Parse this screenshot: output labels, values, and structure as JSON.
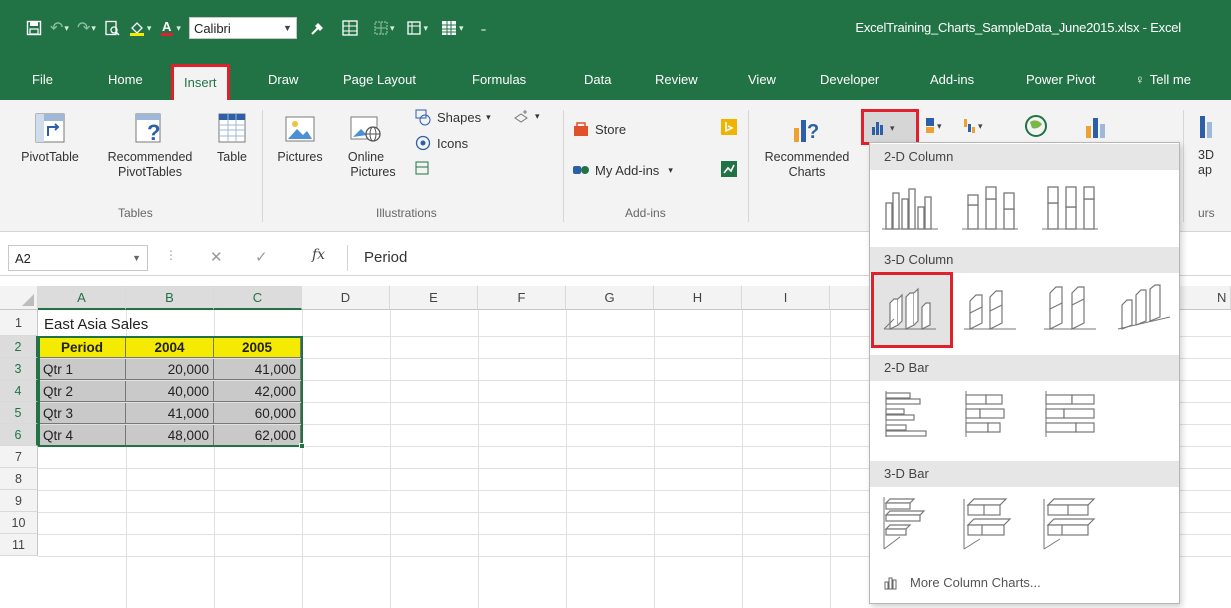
{
  "window": {
    "title": "ExcelTraining_Charts_SampleData_June2015.xlsx  -  Excel",
    "font_name": "Calibri"
  },
  "tabs": [
    "File",
    "Home",
    "Insert",
    "Draw",
    "Page Layout",
    "Formulas",
    "Data",
    "Review",
    "View",
    "Developer",
    "Add-ins",
    "Power Pivot",
    "Tell me"
  ],
  "active_tab": "Insert",
  "ribbon": {
    "tables": {
      "pivot_table": "PivotTable",
      "recommended_1": "Recommended",
      "recommended_2": "PivotTables",
      "table": "Table",
      "label": "Tables"
    },
    "illustrations": {
      "pictures": "Pictures",
      "online_1": "Online",
      "online_2": "Pictures",
      "shapes": "Shapes",
      "icons": "Icons",
      "label": "Illustrations"
    },
    "addins": {
      "store": "Store",
      "my_addins": "My Add-ins",
      "label": "Add-ins"
    },
    "charts": {
      "recommended_1": "Recommended",
      "recommended_2": "Charts"
    },
    "cutoff": {
      "line1": "3D",
      "line2": "ap",
      "label": "urs"
    }
  },
  "formula_bar": {
    "name_box": "A2",
    "content": "Period"
  },
  "grid": {
    "columns": [
      "A",
      "B",
      "C",
      "D",
      "E",
      "F",
      "G",
      "H",
      "I",
      "N"
    ],
    "rows": [
      "1",
      "2",
      "3",
      "4",
      "5",
      "6",
      "7",
      "8",
      "9",
      "10",
      "11"
    ],
    "title_cell": "East Asia Sales",
    "headers": [
      "Period",
      "2004",
      "2005"
    ],
    "data": [
      [
        "Qtr 1",
        "20,000",
        "41,000"
      ],
      [
        "Qtr 2",
        "40,000",
        "42,000"
      ],
      [
        "Qtr 3",
        "41,000",
        "60,000"
      ],
      [
        "Qtr 4",
        "48,000",
        "62,000"
      ]
    ]
  },
  "gallery": {
    "sections": [
      "2-D Column",
      "3-D Column",
      "2-D Bar",
      "3-D Bar"
    ],
    "more": "More Column Charts..."
  },
  "colors": {
    "excel_green": "#217346",
    "highlight_red": "#e0202a",
    "header_yellow": "#f5eb00",
    "data_gray": "#c9c9c9"
  }
}
